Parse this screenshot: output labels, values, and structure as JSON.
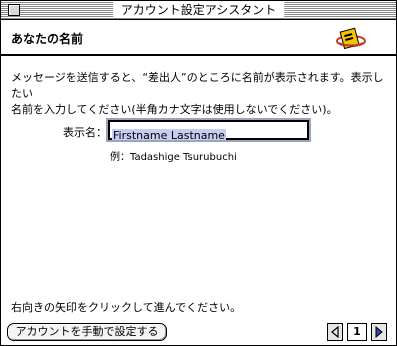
{
  "window": {
    "title": "アカウント設定アシスタント"
  },
  "header": {
    "heading": "あなたの名前",
    "logo_icon": "assistant-logo-icon"
  },
  "instruction": {
    "line1": "メッセージを送信すると、“差出人”のところに名前が表示されます。表示したい",
    "line2": "名前を入力してください(半角カナ文字は使用しないでください)。"
  },
  "form": {
    "name_label": "表示名：",
    "name_value": "Firstname Lastname",
    "example": "例：Tadashige Tsurubuchi"
  },
  "footer": {
    "hint": "右向きの矢印をクリックして進んでください。",
    "manual_button": "アカウントを手動で設定する",
    "page_number": "1"
  }
}
